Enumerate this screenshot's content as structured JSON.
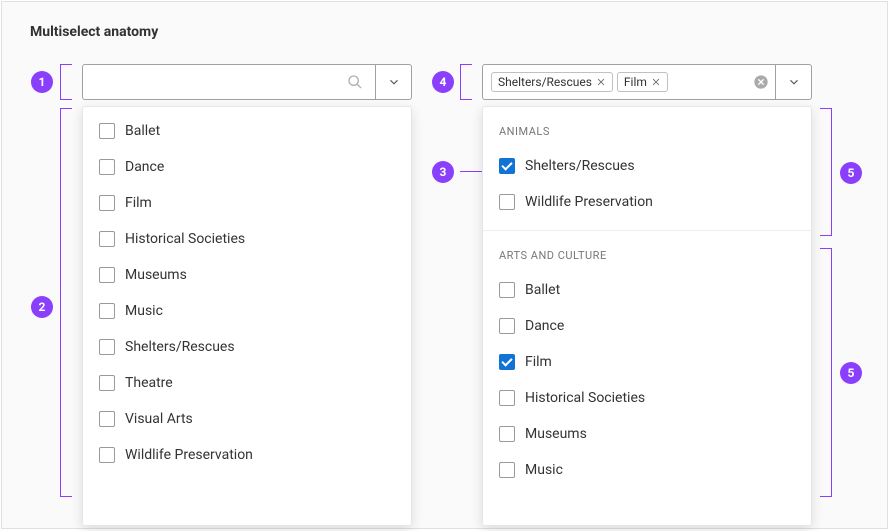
{
  "title": "Multiselect anatomy",
  "badges": {
    "b1": "1",
    "b2": "2",
    "b3": "3",
    "b4": "4",
    "b5a": "5",
    "b5b": "5"
  },
  "left": {
    "options": [
      {
        "label": "Ballet",
        "checked": false
      },
      {
        "label": "Dance",
        "checked": false
      },
      {
        "label": "Film",
        "checked": false
      },
      {
        "label": "Historical Societies",
        "checked": false
      },
      {
        "label": "Museums",
        "checked": false
      },
      {
        "label": "Music",
        "checked": false
      },
      {
        "label": "Shelters/Rescues",
        "checked": false
      },
      {
        "label": "Theatre",
        "checked": false
      },
      {
        "label": "Visual Arts",
        "checked": false
      },
      {
        "label": "Wildlife Preservation",
        "checked": false
      }
    ]
  },
  "right": {
    "chips": [
      {
        "label": "Shelters/Rescues"
      },
      {
        "label": "Film"
      }
    ],
    "groups": [
      {
        "header": "ANIMALS",
        "options": [
          {
            "label": "Shelters/Rescues",
            "checked": true
          },
          {
            "label": "Wildlife Preservation",
            "checked": false
          }
        ]
      },
      {
        "header": "ARTS AND CULTURE",
        "options": [
          {
            "label": "Ballet",
            "checked": false
          },
          {
            "label": "Dance",
            "checked": false
          },
          {
            "label": "Film",
            "checked": true
          },
          {
            "label": "Historical Societies",
            "checked": false
          },
          {
            "label": "Museums",
            "checked": false
          },
          {
            "label": "Music",
            "checked": false
          }
        ]
      }
    ]
  }
}
